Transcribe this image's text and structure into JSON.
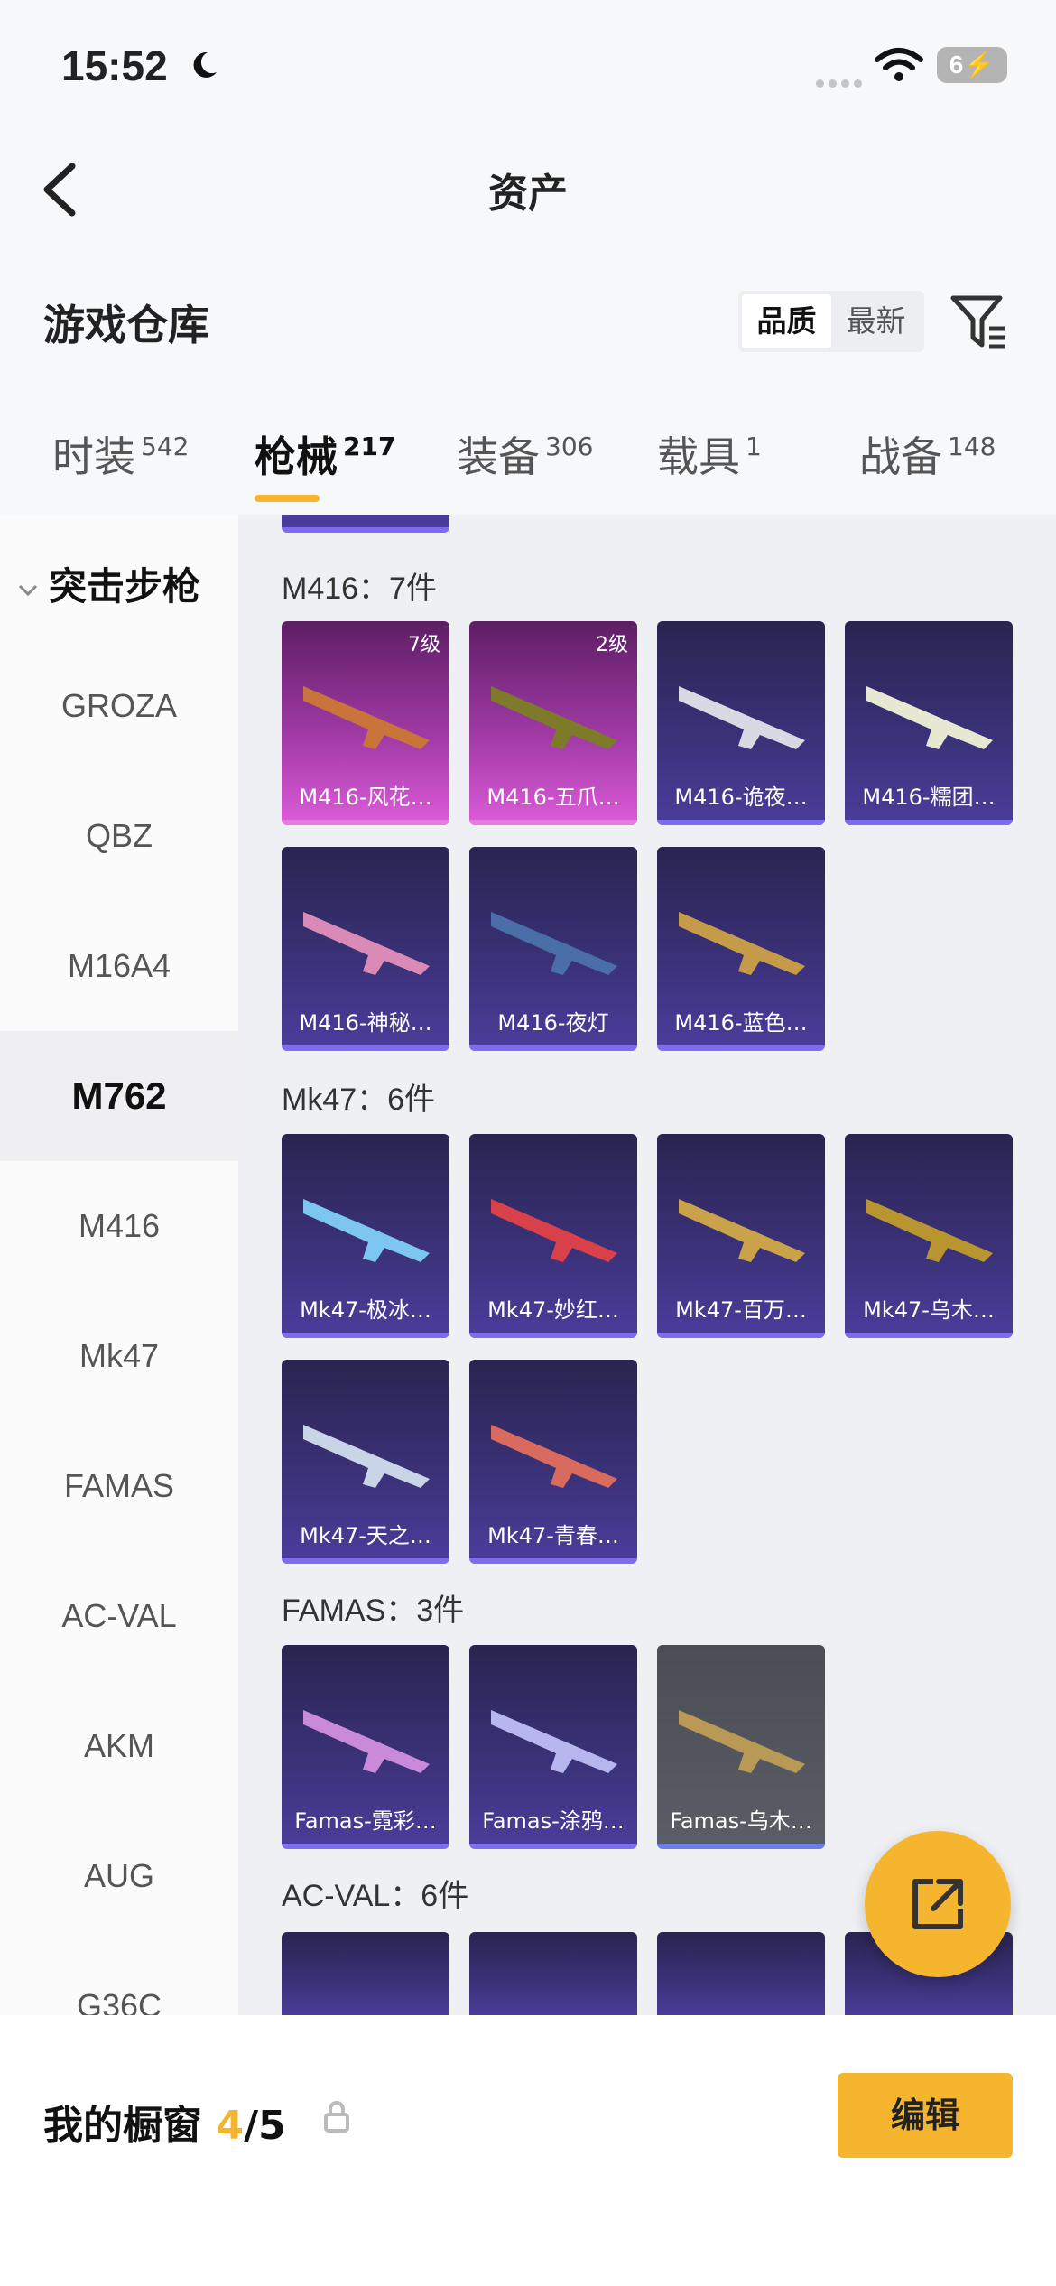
{
  "status_bar": {
    "time": "15:52",
    "battery": "6"
  },
  "header": {
    "title": "资产"
  },
  "warehouse": {
    "title": "游戏仓库",
    "sort_options": [
      "品质",
      "最新"
    ]
  },
  "tabs": [
    {
      "label": "时装",
      "count": "542"
    },
    {
      "label": "枪械",
      "count": "217"
    },
    {
      "label": "装备",
      "count": "306"
    },
    {
      "label": "载具",
      "count": "1"
    },
    {
      "label": "战备",
      "count": "148"
    }
  ],
  "sidebar": {
    "category": "突击步枪",
    "items": [
      "GROZA",
      "QBZ",
      "M16A4",
      "M762",
      "M416",
      "Mk47",
      "FAMAS",
      "AC-VAL",
      "AKM",
      "AUG",
      "G36C"
    ]
  },
  "groups": [
    {
      "title": "M416：7件",
      "items": [
        {
          "label": "M416-风花…",
          "level": "7级"
        },
        {
          "label": "M416-五爪…",
          "level": "2级"
        },
        {
          "label": "M416-诡夜…"
        },
        {
          "label": "M416-糯团…"
        },
        {
          "label": "M416-神秘…"
        },
        {
          "label": "M416-夜灯"
        },
        {
          "label": "M416-蓝色…"
        }
      ]
    },
    {
      "title": "Mk47：6件",
      "items": [
        {
          "label": "Mk47-极冰…"
        },
        {
          "label": "Mk47-妙红…"
        },
        {
          "label": "Mk47-百万…"
        },
        {
          "label": "Mk47-乌木…"
        },
        {
          "label": "Mk47-天之…"
        },
        {
          "label": "Mk47-青春…"
        }
      ]
    },
    {
      "title": "FAMAS：3件",
      "items": [
        {
          "label": "Famas-霓彩…"
        },
        {
          "label": "Famas-涂鸦…"
        },
        {
          "label": "Famas-乌木…"
        }
      ]
    },
    {
      "title": "AC-VAL：6件"
    }
  ],
  "bottom": {
    "showcase_label": "我的橱窗",
    "current": "4",
    "total": "/5",
    "edit_label": "编辑"
  }
}
